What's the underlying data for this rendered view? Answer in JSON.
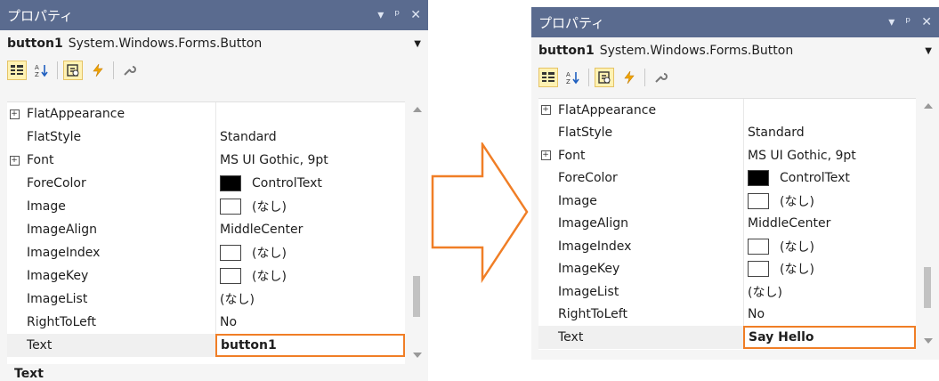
{
  "left": {
    "title": "プロパティ",
    "title_controls": [
      "▾",
      "ᵖ",
      "✕"
    ],
    "object_name": "button1",
    "object_type": "System.Windows.Forms.Button",
    "rows": [
      {
        "expand": "+",
        "name": "FlatAppearance",
        "value": ""
      },
      {
        "expand": "",
        "name": "FlatStyle",
        "value": "Standard"
      },
      {
        "expand": "+",
        "name": "Font",
        "value": "MS UI Gothic, 9pt"
      },
      {
        "expand": "",
        "name": "ForeColor",
        "value": "ControlText",
        "swatch": "black"
      },
      {
        "expand": "",
        "name": "Image",
        "value": "(なし)",
        "swatch": "white"
      },
      {
        "expand": "",
        "name": "ImageAlign",
        "value": "MiddleCenter"
      },
      {
        "expand": "",
        "name": "ImageIndex",
        "value": "(なし)",
        "swatch": "white"
      },
      {
        "expand": "",
        "name": "ImageKey",
        "value": "(なし)",
        "swatch": "white"
      },
      {
        "expand": "",
        "name": "ImageList",
        "value": "(なし)"
      },
      {
        "expand": "",
        "name": "RightToLeft",
        "value": "No"
      },
      {
        "expand": "",
        "name": "Text",
        "value": "button1",
        "selected": true
      }
    ],
    "description_title": "Text"
  },
  "right": {
    "title": "プロパティ",
    "title_controls": [
      "▾",
      "ᵖ",
      "✕"
    ],
    "object_name": "button1",
    "object_type": "System.Windows.Forms.Button",
    "rows": [
      {
        "expand": "+",
        "name": "FlatAppearance",
        "value": ""
      },
      {
        "expand": "",
        "name": "FlatStyle",
        "value": "Standard"
      },
      {
        "expand": "+",
        "name": "Font",
        "value": "MS UI Gothic, 9pt"
      },
      {
        "expand": "",
        "name": "ForeColor",
        "value": "ControlText",
        "swatch": "black"
      },
      {
        "expand": "",
        "name": "Image",
        "value": "(なし)",
        "swatch": "white"
      },
      {
        "expand": "",
        "name": "ImageAlign",
        "value": "MiddleCenter"
      },
      {
        "expand": "",
        "name": "ImageIndex",
        "value": "(なし)",
        "swatch": "white"
      },
      {
        "expand": "",
        "name": "ImageKey",
        "value": "(なし)",
        "swatch": "white"
      },
      {
        "expand": "",
        "name": "ImageList",
        "value": "(なし)"
      },
      {
        "expand": "",
        "name": "RightToLeft",
        "value": "No"
      },
      {
        "expand": "",
        "name": "Text",
        "value": "Say Hello",
        "selected": true
      }
    ]
  },
  "colors": {
    "titlebar": "#5a6b8f",
    "highlight_border": "#f07e26",
    "active_tool": "#fff2b3",
    "arrow_stroke": "#f07e26"
  },
  "toolbar_icons": [
    "categorized-icon",
    "alphabetical-icon",
    "properties-icon",
    "events-icon",
    "property-pages-icon"
  ]
}
